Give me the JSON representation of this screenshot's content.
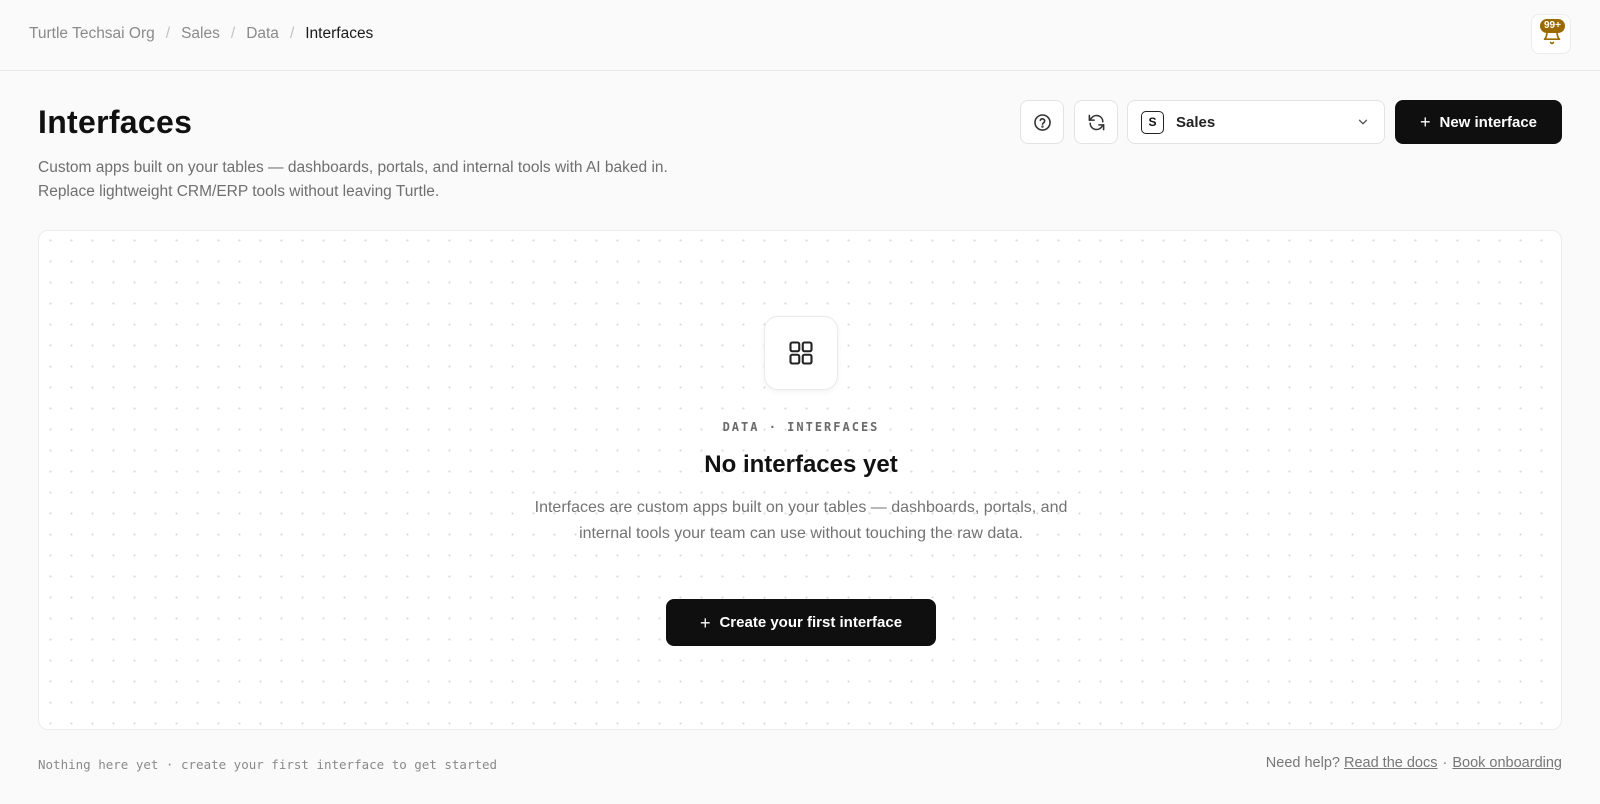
{
  "breadcrumb": {
    "items": [
      "Turtle Techsai Org",
      "Sales",
      "Data",
      "Interfaces"
    ],
    "separator": "/"
  },
  "notifications": {
    "badge": "99+",
    "icon": "bell-icon"
  },
  "header": {
    "title": "Interfaces",
    "subtitle_line1": "Custom apps built on your tables — dashboards, portals, and internal tools with AI baked in.",
    "subtitle_line2": "Replace lightweight CRM/ERP tools without leaving Turtle."
  },
  "toolbar": {
    "help_icon": "help-circle-icon",
    "refresh_icon": "refresh-icon",
    "workspace": {
      "letter": "S",
      "label": "Sales"
    },
    "new_button": {
      "plus": "+",
      "label": "New interface"
    }
  },
  "empty_state": {
    "icon": "grid-icon",
    "eyebrow": "DATA · INTERFACES",
    "title": "No interfaces yet",
    "description": "Interfaces are custom apps built on your tables — dashboards, portals, and internal tools your team can use without touching the raw data.",
    "cta": {
      "plus": "+",
      "label": "Create your first interface"
    }
  },
  "footer": {
    "status": "Nothing here yet · create your first interface to get started",
    "help_prefix": "Need help?",
    "docs_link": "Read the docs",
    "separator": "·",
    "onboarding_link": "Book onboarding"
  },
  "colors": {
    "primary_button": "#0f0f0f",
    "badge": "#9a6a00",
    "background": "#fafafa"
  }
}
